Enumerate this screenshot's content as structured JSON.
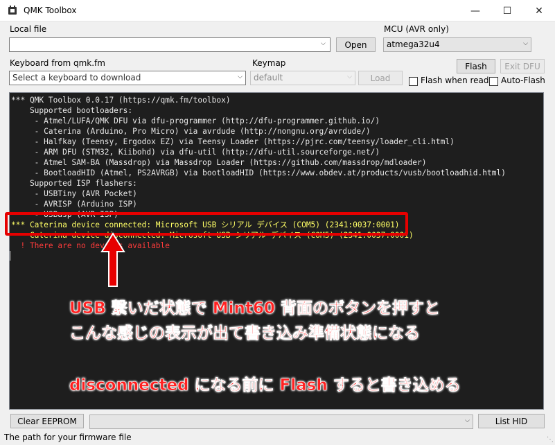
{
  "window": {
    "title": "QMK Toolbox",
    "min_icon": "minimize-icon",
    "max_icon": "maximize-icon",
    "close_icon": "close-icon"
  },
  "local_file": {
    "label": "Local file",
    "value": "",
    "open_label": "Open"
  },
  "mcu": {
    "label": "MCU (AVR only)",
    "value": "atmega32u4"
  },
  "keyboard": {
    "label": "Keyboard from qmk.fm",
    "placeholder": "Select a keyboard to download"
  },
  "keymap": {
    "label": "Keymap",
    "value": "default",
    "load_label": "Load"
  },
  "actions": {
    "flash_label": "Flash",
    "exit_dfu_label": "Exit DFU",
    "flash_when_ready_label": "Flash when ready",
    "auto_flash_label": "Auto-Flash"
  },
  "console": {
    "lines": [
      "*** QMK Toolbox 0.0.17 (https://qmk.fm/toolbox)",
      "    Supported bootloaders:",
      "     - Atmel/LUFA/QMK DFU via dfu-programmer (http://dfu-programmer.github.io/)",
      "     - Caterina (Arduino, Pro Micro) via avrdude (http://nongnu.org/avrdude/)",
      "     - Halfkay (Teensy, Ergodox EZ) via Teensy Loader (https://pjrc.com/teensy/loader_cli.html)",
      "     - ARM DFU (STM32, Kiibohd) via dfu-util (http://dfu-util.sourceforge.net/)",
      "     - Atmel SAM-BA (Massdrop) via Massdrop Loader (https://github.com/massdrop/mdloader)",
      "     - BootloadHID (Atmel, PS2AVRGB) via bootloadHID (https://www.obdev.at/products/vusb/bootloadhid.html)",
      "    Supported ISP flashers:",
      "     - USBTiny (AVR Pocket)",
      "     - AVRISP (Arduino ISP)",
      "     - USBasp (AVR ISP)"
    ],
    "connected_line": "*** Caterina device connected: Microsoft USB シリアル デバイス (COM5) (2341:0037:0001)",
    "disconnected_line": "    Caterina device disconnected: Microsoft USB シリアル デバイス (COM5) (2341:0037:0001)",
    "error_line": "  ! There are no devices available"
  },
  "annotation": {
    "line1": "USB 繋いだ状態で Mint60 背面のボタンを押すと",
    "line2": "こんな感じの表示が出て書き込み準備状態になる",
    "line3": "disconnected になる前に Flash すると書き込める",
    "color": "#ff2020"
  },
  "bottom": {
    "clear_eeprom_label": "Clear EEPROM",
    "hid_value": "",
    "list_hid_label": "List HID"
  },
  "status": {
    "text": "The path for your firmware file"
  }
}
